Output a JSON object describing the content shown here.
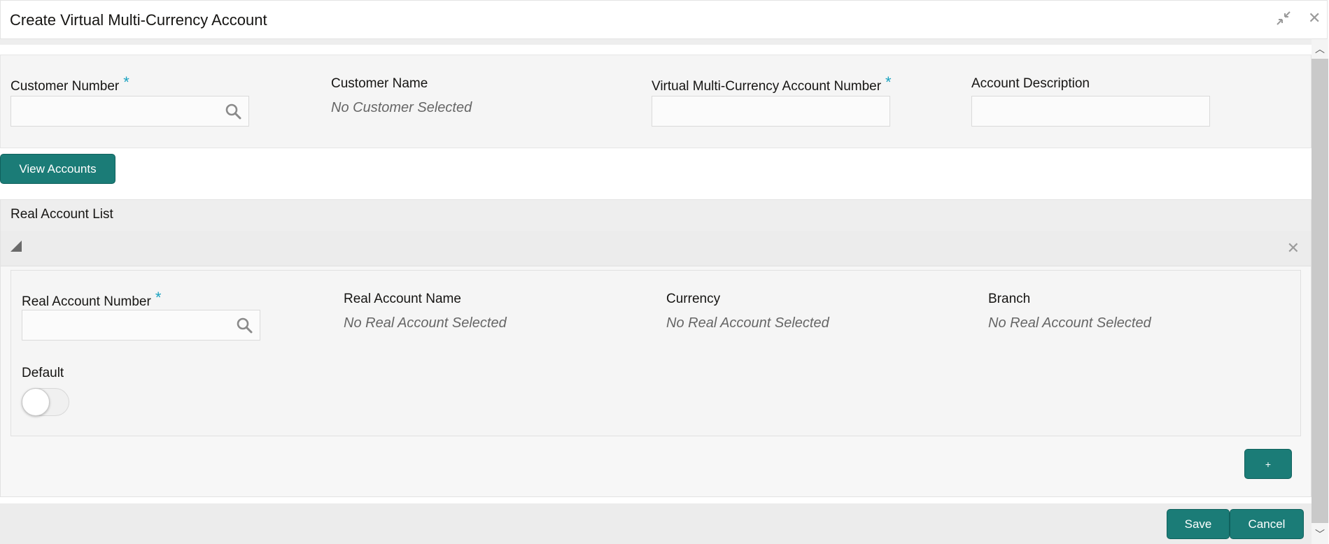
{
  "header": {
    "title": "Create Virtual Multi-Currency Account",
    "minimize_icon": "minimize-icon",
    "close_icon": "close-icon"
  },
  "form": {
    "customer_number": {
      "label": "Customer Number",
      "required": "*",
      "value": ""
    },
    "customer_name": {
      "label": "Customer Name",
      "value": "No Customer Selected"
    },
    "vmca_number": {
      "label": "Virtual Multi-Currency Account Number",
      "required": "*",
      "value": ""
    },
    "account_description": {
      "label": "Account Description",
      "value": ""
    }
  },
  "view_accounts_label": "View Accounts",
  "real_account_list": {
    "title": "Real Account List",
    "real_account_number": {
      "label": "Real Account Number",
      "required": "*",
      "value": ""
    },
    "real_account_name": {
      "label": "Real Account Name",
      "value": "No Real Account Selected"
    },
    "currency": {
      "label": "Currency",
      "value": "No Real Account Selected"
    },
    "branch": {
      "label": "Branch",
      "value": "No Real Account Selected"
    },
    "default": {
      "label": "Default",
      "checked": false
    },
    "add_label": "+"
  },
  "footer": {
    "save_label": "Save",
    "cancel_label": "Cancel"
  },
  "colors": {
    "accent": "#1b7c77",
    "required": "#1aa2c0",
    "placeholder": "#666666"
  }
}
